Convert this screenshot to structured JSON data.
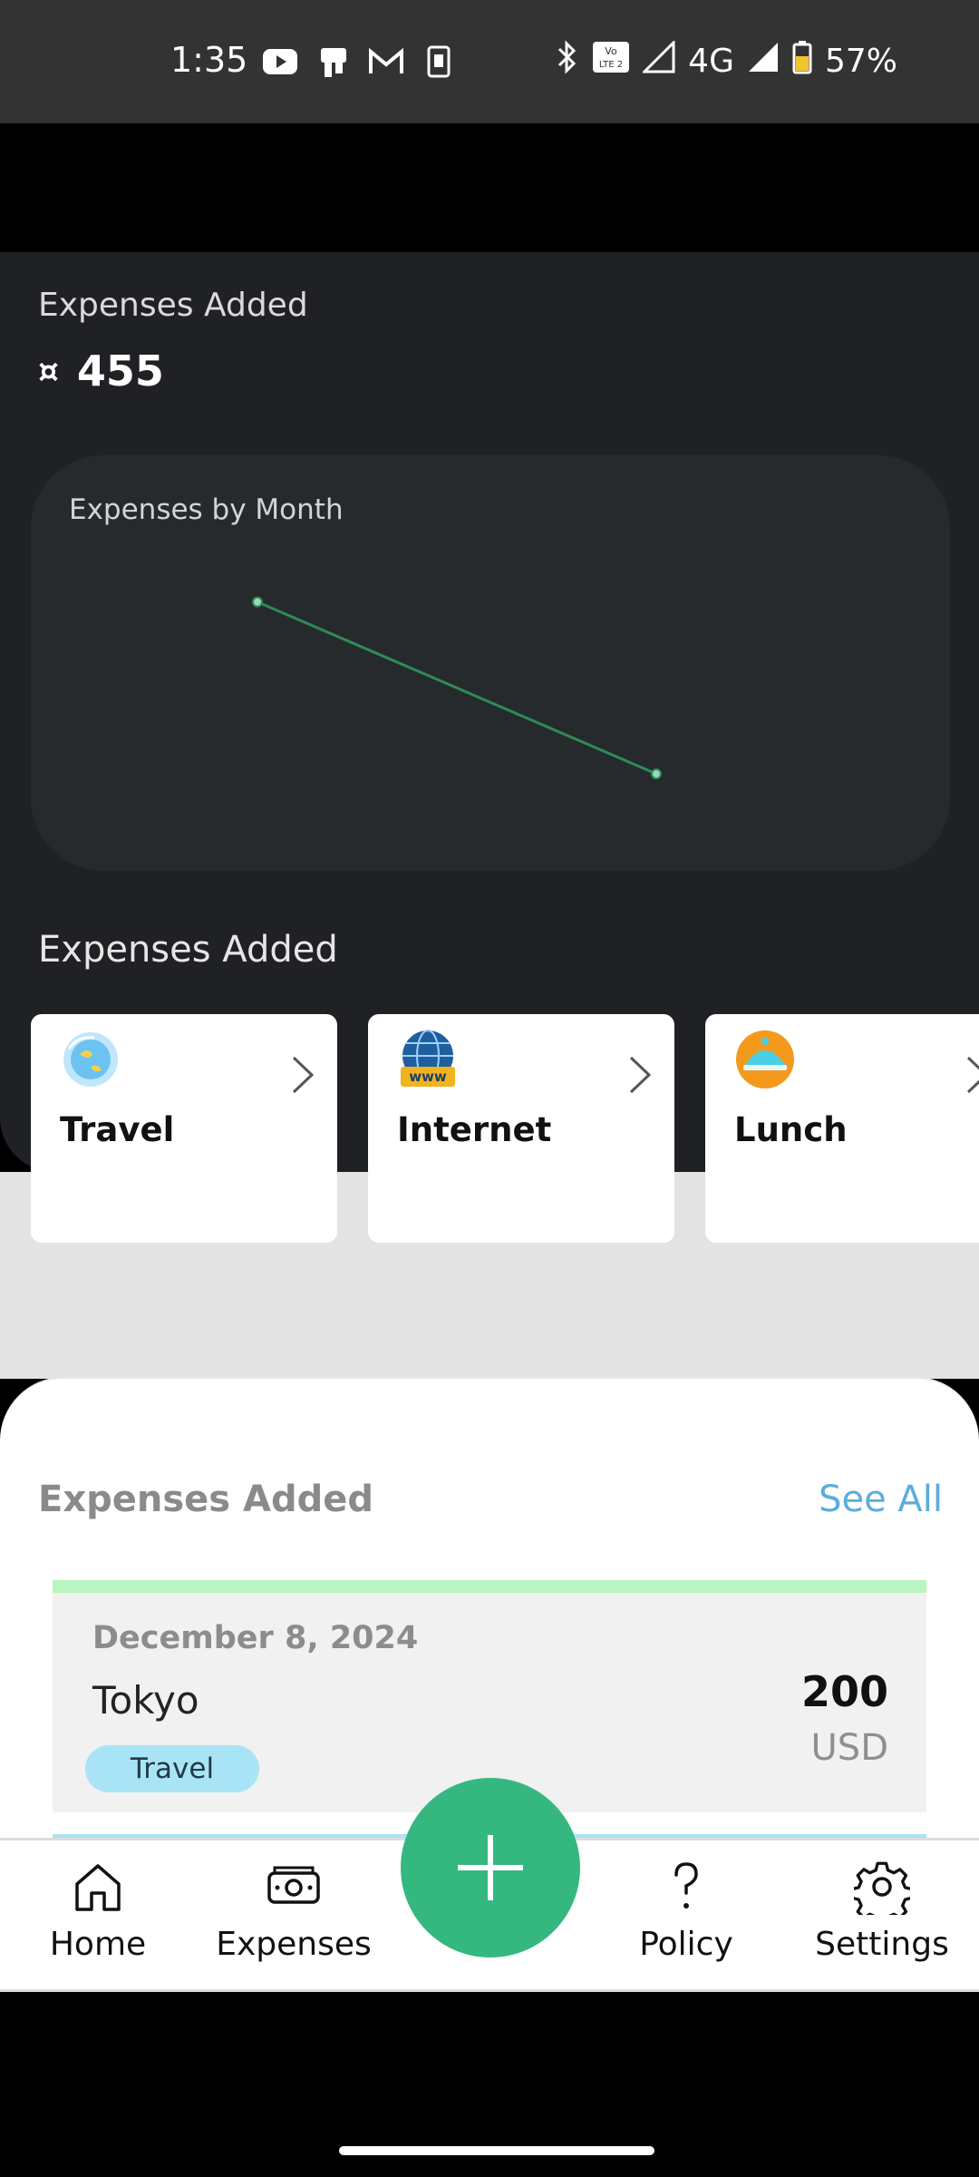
{
  "status_bar": {
    "time": "1:35",
    "network": "4G",
    "battery": "57%",
    "icons": [
      "youtube-icon",
      "store-icon",
      "gmail-icon",
      "sim-icon",
      "bluetooth-icon",
      "volte-icon",
      "signal-icon",
      "battery-icon"
    ]
  },
  "summary": {
    "label": "Expenses Added",
    "currency_symbol": "¤",
    "amount": "455"
  },
  "chart": {
    "title": "Expenses by Month",
    "line_color": "#2e8b57"
  },
  "chart_data": {
    "type": "line",
    "title": "Expenses by Month",
    "x": [
      1,
      2
    ],
    "series": [
      {
        "values": [
          255,
          200
        ]
      }
    ],
    "ylim": [
      180,
      270
    ],
    "grid": false,
    "legend": "none"
  },
  "categories_section": {
    "title": "Expenses Added",
    "items": [
      {
        "label": "Travel",
        "icon": "travel-icon"
      },
      {
        "label": "Internet",
        "icon": "internet-icon"
      },
      {
        "label": "Lunch",
        "icon": "lunch-icon"
      }
    ]
  },
  "recent": {
    "title": "Expenses Added",
    "see_all": "See All",
    "items": [
      {
        "date": "December 8, 2024",
        "name": "Tokyo",
        "amount": "200",
        "currency": "USD",
        "category": "Travel",
        "accent_color": "#b9f5bf"
      }
    ]
  },
  "nav": {
    "home": "Home",
    "expenses": "Expenses",
    "policy": "Policy",
    "settings": "Settings",
    "fab_icon": "plus-icon"
  },
  "colors": {
    "accent": "#35b880",
    "link": "#5aaedd",
    "tag": "#a9e4f6"
  }
}
